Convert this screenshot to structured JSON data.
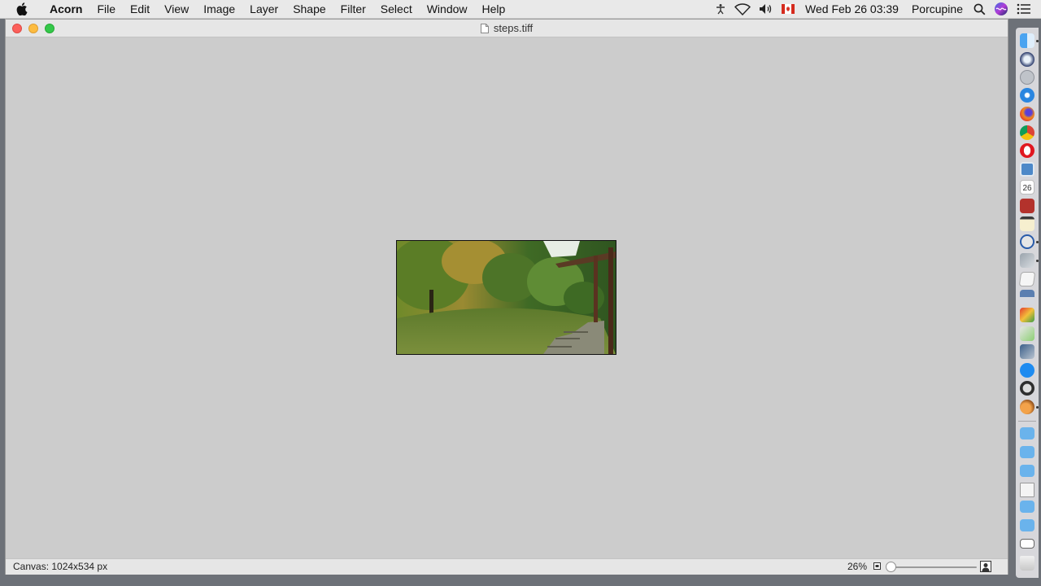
{
  "menubar": {
    "app_name": "Acorn",
    "items": [
      "File",
      "Edit",
      "View",
      "Image",
      "Layer",
      "Shape",
      "Filter",
      "Select",
      "Window",
      "Help"
    ],
    "status": {
      "datetime": "Wed Feb 26  03:39",
      "user": "Porcupine"
    }
  },
  "window": {
    "title": "steps.tiff",
    "status": {
      "canvas_info": "Canvas: 1024x534 px",
      "zoom": "26%"
    }
  },
  "colors": {
    "close": "#fc605b",
    "minimize": "#fdbc40",
    "maximize": "#34c84a",
    "canvas_background": "#cccccc"
  },
  "dock": {
    "items": [
      "finder-icon",
      "photos-icon",
      "launchpad-icon",
      "safari-icon",
      "firefox-icon",
      "chrome-icon",
      "opera-icon",
      "preview-icon",
      "calendar-icon",
      "dictionary-icon",
      "notes-icon",
      "bbedit-icon",
      "image-capture-icon",
      "textedit-icon",
      "scanner-icon",
      "paint-icon",
      "photo-browser-icon",
      "image-editor-icon",
      "app-store-icon",
      "time-machine-icon",
      "acorn-icon"
    ],
    "calendar_day": "26",
    "folders": [
      "folder-icon",
      "folder-icon",
      "folder-icon",
      "document-icon",
      "folder-icon",
      "folder-icon",
      "keyboard-icon",
      "trash-icon"
    ]
  }
}
